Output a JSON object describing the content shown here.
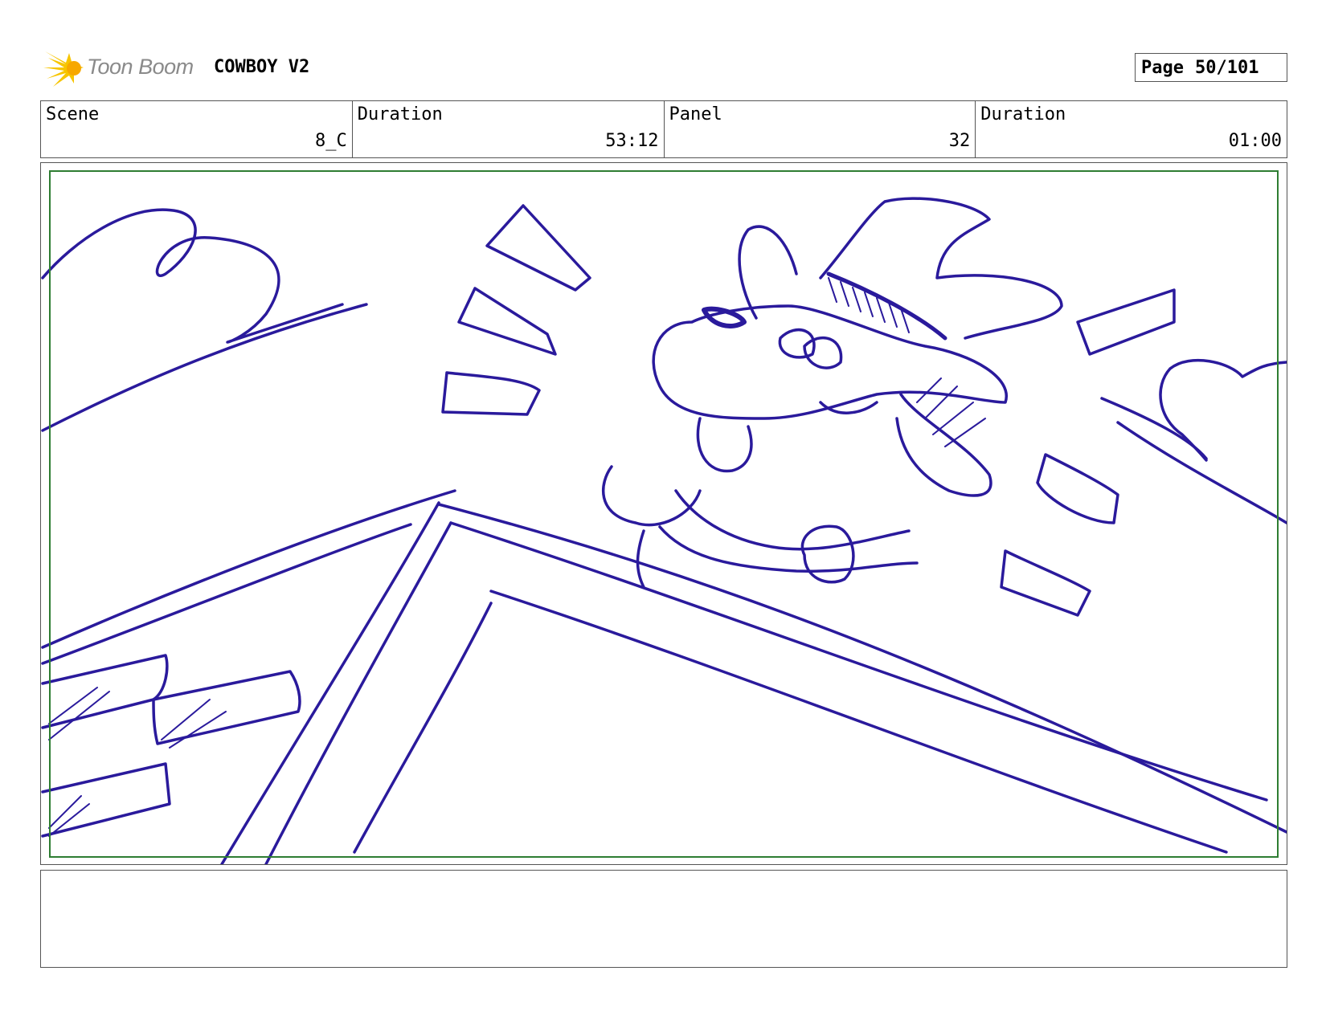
{
  "header": {
    "logo_text": "Toon Boom",
    "project_title": "COWBOY V2",
    "page_label": "Page",
    "page_value": "50/101"
  },
  "info": {
    "scene_label": "Scene",
    "scene_value": "8_C",
    "scene_duration_label": "Duration",
    "scene_duration_value": "53:12",
    "panel_label": "Panel",
    "panel_value": "32",
    "panel_duration_label": "Duration",
    "panel_duration_value": "01:00"
  },
  "colors": {
    "sketch": "#2a1a9c",
    "safe_frame": "#2e7d32",
    "logo_yellow": "#f7c500"
  }
}
